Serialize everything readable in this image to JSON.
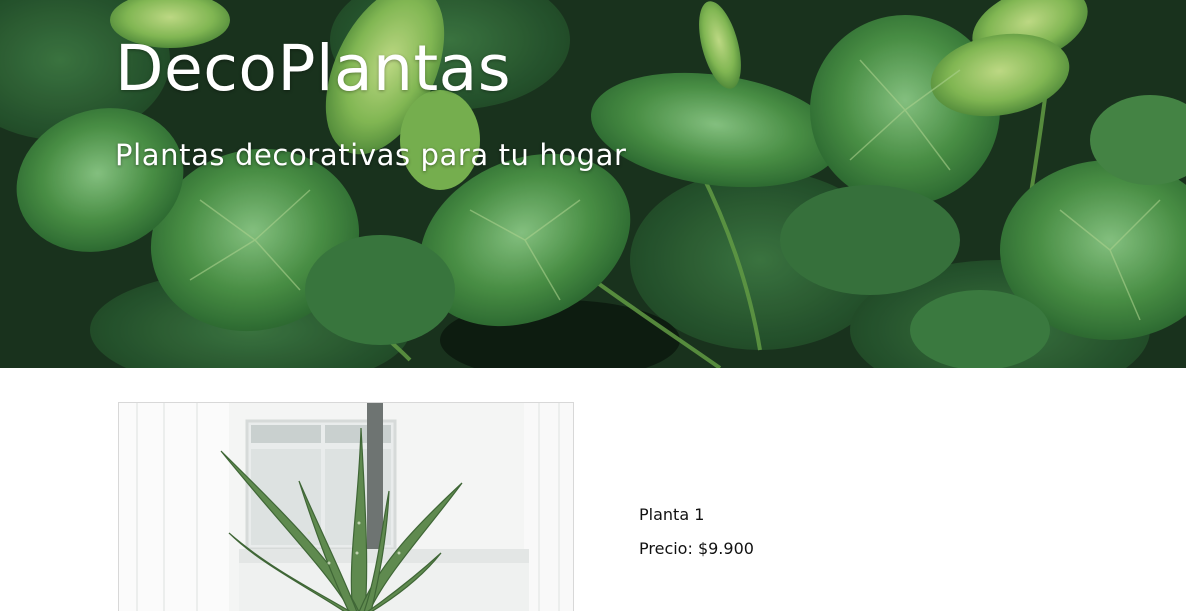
{
  "site": {
    "title": "DecoPlantas",
    "subtitle": "Plantas decorativas para tu hogar"
  },
  "hero": {
    "image_subject": "lotus-leaves-photo"
  },
  "products": [
    {
      "name": "Planta 1",
      "price": "Precio: $9.900",
      "image_subject": "aloe-vera-photo"
    }
  ],
  "colors": {
    "hero_dark": "#1d3a22",
    "leaf_green": "#4f9a4a",
    "leaf_light": "#a9d66a",
    "text_on_hero": "#ffffff",
    "body_text": "#111111",
    "page_background": "#ffffff"
  }
}
